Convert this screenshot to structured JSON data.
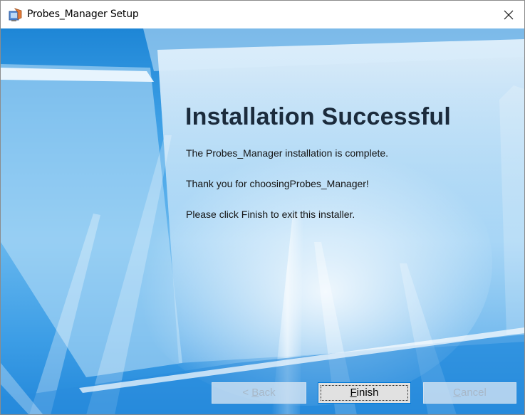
{
  "window": {
    "title": "Probes_Manager Setup",
    "icon": "installer-app-icon",
    "close_icon": "close-icon"
  },
  "main": {
    "heading": "Installation Successful",
    "line1": "The Probes_Manager installation is complete.",
    "line2": "Thank you for choosingProbes_Manager!",
    "line3": "Please click Finish to exit this installer."
  },
  "buttons": {
    "back": {
      "mnemonic": "B",
      "rest": "ack",
      "prefix": "< ",
      "enabled": false
    },
    "finish": {
      "mnemonic": "F",
      "rest": "inish",
      "enabled": true,
      "focused": true
    },
    "cancel": {
      "mnemonic": "C",
      "rest": "ancel",
      "enabled": false
    }
  },
  "colors": {
    "background_blue": "#3ea0e6",
    "heading": "#1b2b3c",
    "focus_border": "#0078d7"
  }
}
